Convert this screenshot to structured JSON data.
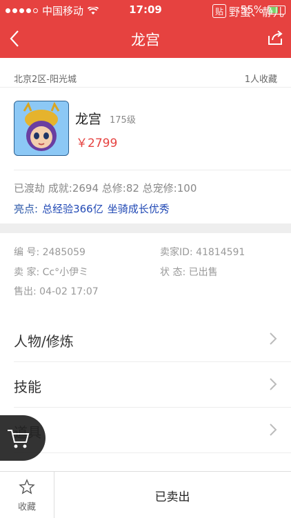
{
  "status_bar": {
    "carrier": "中国移动",
    "time": "17:09",
    "battery": "55%",
    "watermark_text": "野蛮、静儿",
    "watermark_badge": "贴"
  },
  "nav": {
    "title": "龙宫"
  },
  "listing": {
    "server": "北京2区-阳光城",
    "favorites": "1人收藏",
    "name": "龙宫",
    "level": "175级",
    "price": "￥2799",
    "achievements": "已渡劫 成就:2694 总修:82 总宠修:100",
    "highlight_label": "亮点:",
    "highlight_tags": [
      "总经验366亿",
      "坐骑成长优秀"
    ]
  },
  "details": {
    "id": "编  号: 2485059",
    "seller_id": "卖家ID: 41814591",
    "seller": "卖  家: Cc°小伊ミ",
    "status": "状  态: 已出售",
    "sold_time": "售出: 04-02 17:07"
  },
  "menu": [
    {
      "label": "人物/修炼"
    },
    {
      "label": "技能"
    },
    {
      "label": "道具"
    }
  ],
  "bottom_bar": {
    "favorite_label": "收藏",
    "sold_label": "已卖出"
  },
  "colors": {
    "brand_red": "#e64240",
    "price_red": "#e64240",
    "link_blue": "#2b57a8"
  }
}
